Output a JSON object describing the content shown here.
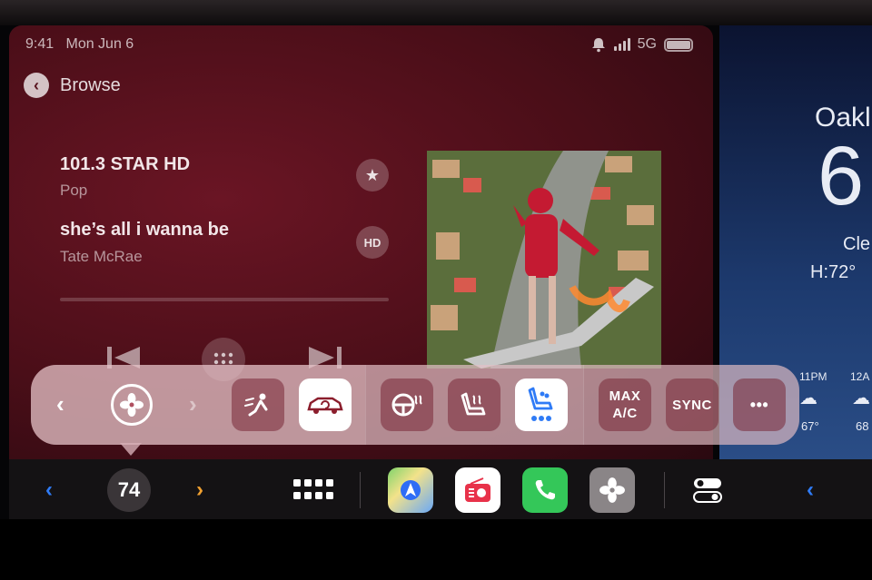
{
  "status": {
    "time": "9:41",
    "date": "Mon Jun 6",
    "network": "5G"
  },
  "nav": {
    "back_label": "Browse"
  },
  "now_playing": {
    "station": "101.3 STAR HD",
    "genre": "Pop",
    "song": "she’s all i wanna be",
    "artist": "Tate McRae",
    "favorite_icon": "star-icon",
    "hd_badge": "HD"
  },
  "weather": {
    "city": "Oakl",
    "temperature": "6",
    "condition": "Cle",
    "high": "H:72°",
    "forecast": [
      {
        "time": "11PM",
        "icon": "cloud-moon-icon",
        "temp": "67°"
      },
      {
        "time": "12A",
        "icon": "cloud-storm-icon",
        "temp": "68"
      }
    ]
  },
  "climate": {
    "max_ac_label": "MAX\nA/C",
    "sync_label": "SYNC",
    "more_label": "•••",
    "accent": "#8b1d2c"
  },
  "dock": {
    "temperature": "74",
    "apps": [
      "maps-icon",
      "radio-icon",
      "phone-icon",
      "fan-icon"
    ],
    "left_arrow_color": "#2f7bf6",
    "right_arrow_color": "#f0a030"
  }
}
